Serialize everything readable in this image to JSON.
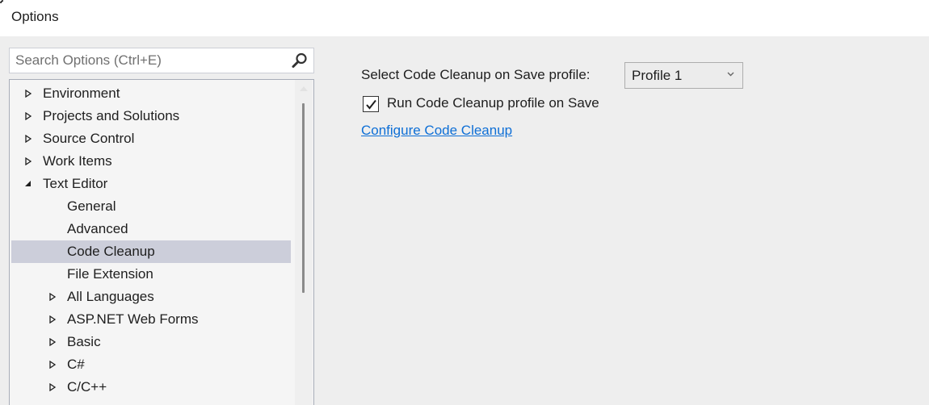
{
  "window": {
    "title": "Options"
  },
  "search": {
    "placeholder": "Search Options (Ctrl+E)",
    "value": "",
    "icon": "search-icon"
  },
  "tree": {
    "items": [
      {
        "label": "Environment",
        "level": 0,
        "expander": "collapsed",
        "selected": false
      },
      {
        "label": "Projects and Solutions",
        "level": 0,
        "expander": "collapsed",
        "selected": false
      },
      {
        "label": "Source Control",
        "level": 0,
        "expander": "collapsed",
        "selected": false
      },
      {
        "label": "Work Items",
        "level": 0,
        "expander": "collapsed",
        "selected": false
      },
      {
        "label": "Text Editor",
        "level": 0,
        "expander": "expanded",
        "selected": false
      },
      {
        "label": "General",
        "level": 1,
        "expander": "none",
        "selected": false
      },
      {
        "label": "Advanced",
        "level": 1,
        "expander": "none",
        "selected": false
      },
      {
        "label": "Code Cleanup",
        "level": 1,
        "expander": "none",
        "selected": true
      },
      {
        "label": "File Extension",
        "level": 1,
        "expander": "none",
        "selected": false
      },
      {
        "label": "All Languages",
        "level": 1,
        "expander": "collapsed",
        "selected": false
      },
      {
        "label": "ASP.NET Web Forms",
        "level": 1,
        "expander": "collapsed",
        "selected": false
      },
      {
        "label": "Basic",
        "level": 1,
        "expander": "collapsed",
        "selected": false
      },
      {
        "label": "C#",
        "level": 1,
        "expander": "collapsed",
        "selected": false
      },
      {
        "label": "C/C++",
        "level": 1,
        "expander": "collapsed",
        "selected": false
      }
    ]
  },
  "settings": {
    "profile_label": "Select Code Cleanup on Save profile:",
    "profile_selected": "Profile 1",
    "run_on_save_label": "Run Code Cleanup profile on Save",
    "run_on_save_checked": true,
    "configure_link": "Configure Code Cleanup"
  },
  "colors": {
    "selection": "#ccceda",
    "link": "#0e6fd6",
    "panel_bg": "#eeeeee",
    "tree_bg": "#f5f5f5"
  }
}
